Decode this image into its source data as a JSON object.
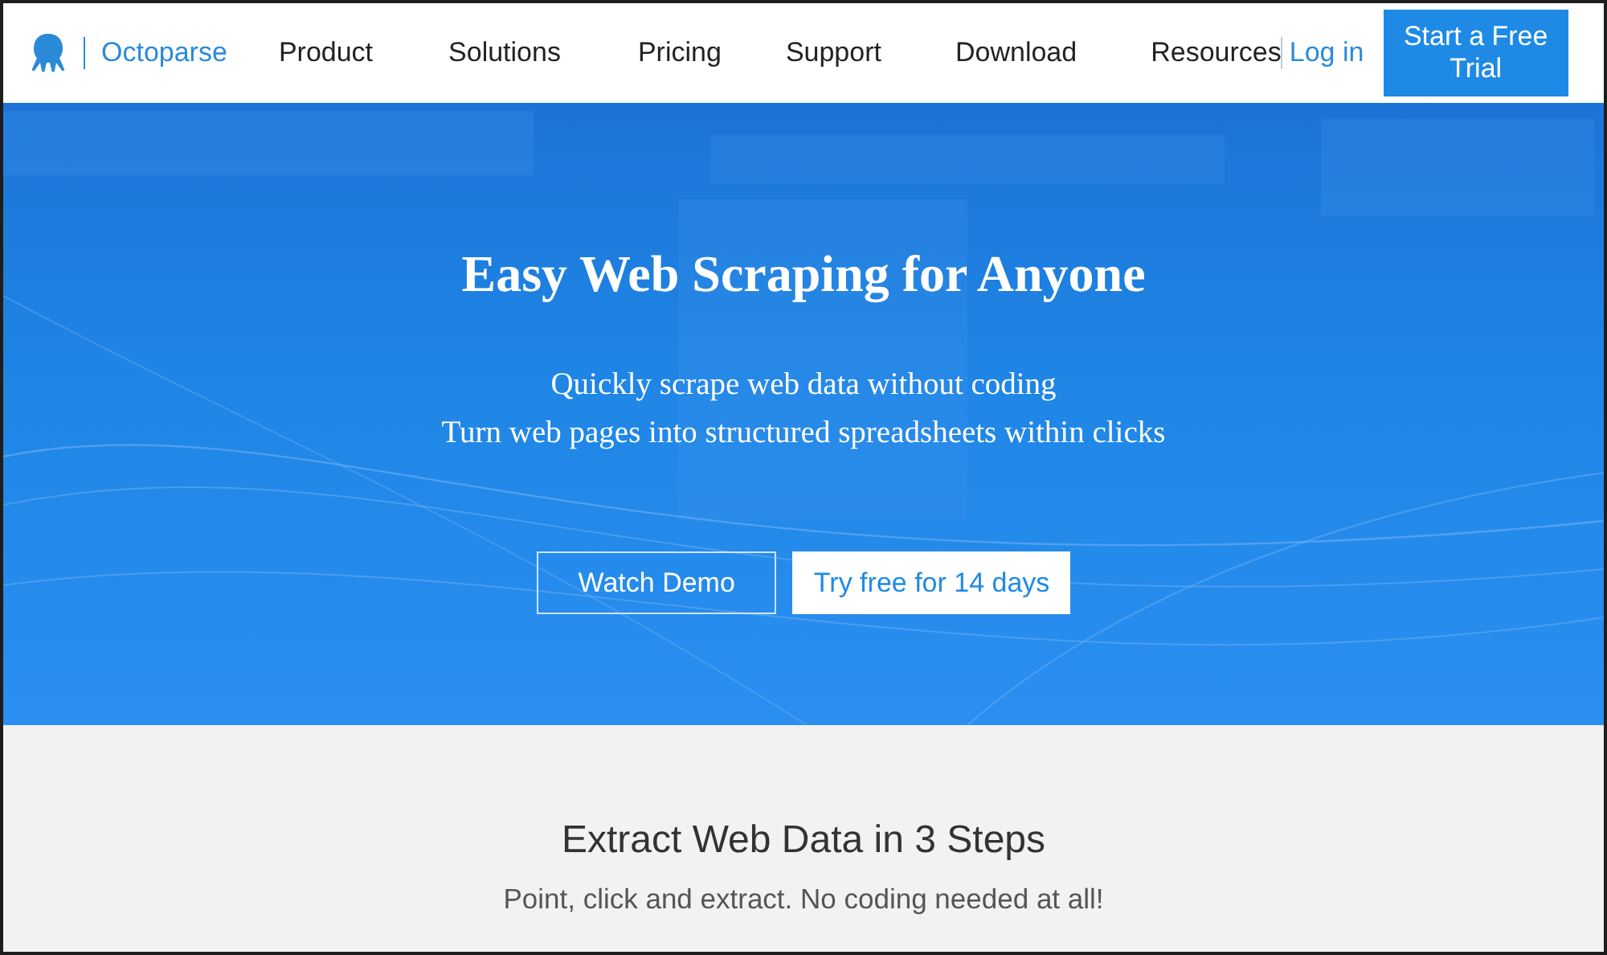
{
  "header": {
    "logo_text": "Octoparse",
    "nav": [
      {
        "label": "Product"
      },
      {
        "label": "Solutions"
      },
      {
        "label": "Pricing"
      },
      {
        "label": "Support"
      },
      {
        "label": "Download"
      },
      {
        "label": "Resources"
      }
    ],
    "login": "Log in",
    "cta": "Start a Free Trial"
  },
  "hero": {
    "title": "Easy Web Scraping for Anyone",
    "subtitles": [
      "Quickly scrape web data without coding",
      "Turn web pages into structured spreadsheets within clicks"
    ],
    "buttons": [
      {
        "label": "Watch Demo",
        "kind": "outline"
      },
      {
        "label": "Try free for 14 days",
        "kind": "solid"
      }
    ]
  },
  "steps": {
    "title": "Extract Web Data in 3 Steps",
    "subtitle": "Point, click and extract. No coding needed at all!"
  }
}
